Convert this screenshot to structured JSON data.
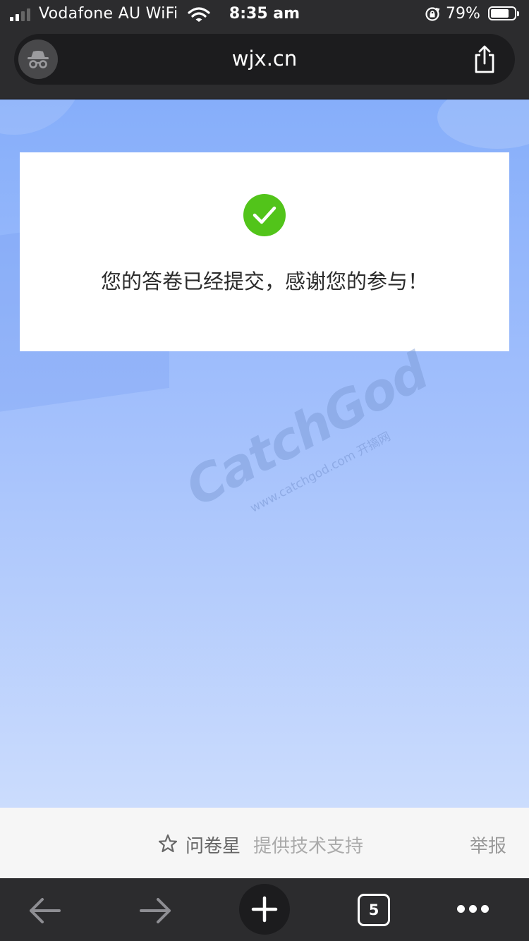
{
  "status_bar": {
    "carrier": "Vodafone AU WiFi",
    "time": "8:35 am",
    "battery_percent": "79%",
    "battery_level": 0.79,
    "signal_bars": 2
  },
  "browser": {
    "url": "wjx.cn",
    "open_tabs": "5",
    "icons": {
      "incognito": "incognito-icon",
      "share": "share-icon",
      "back": "back-arrow-icon",
      "forward": "forward-arrow-icon",
      "new_tab": "plus-icon",
      "more": "more-icon"
    }
  },
  "page": {
    "success_message": "您的答卷已经提交，感谢您的参与！",
    "watermark": {
      "logo": "CatchGod",
      "sub": "www.catchgod.com 开搞网"
    },
    "footer": {
      "brand": "问卷星",
      "support": "提供技术支持",
      "report": "举报"
    }
  },
  "colors": {
    "success_green": "#52c41a",
    "page_gradient_top": "#86aefa",
    "page_gradient_bottom": "#cbdcfd",
    "chrome_dark": "#2c2c2e"
  }
}
